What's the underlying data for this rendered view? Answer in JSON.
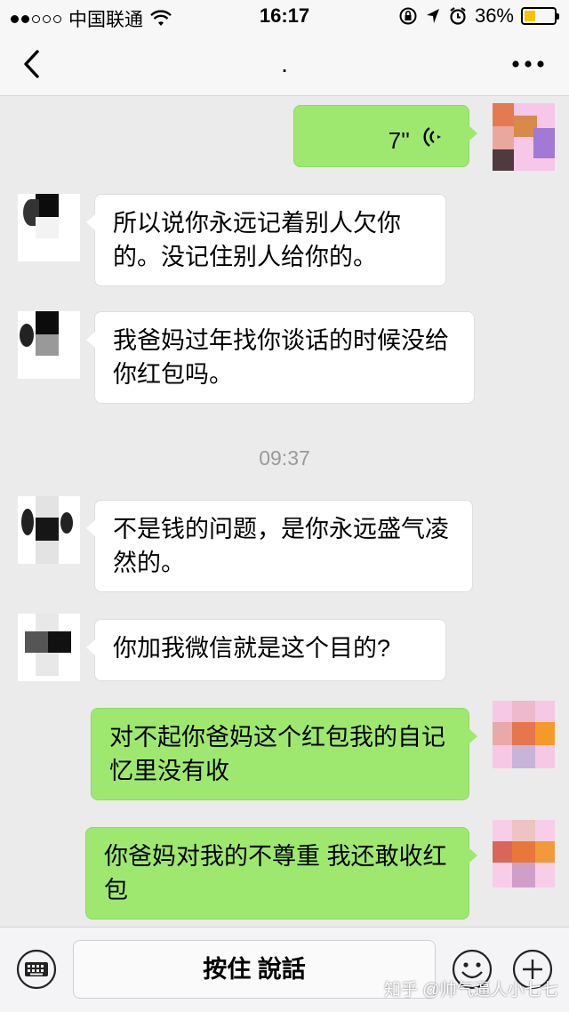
{
  "status_bar": {
    "carrier": "中国联通",
    "time": "16:17",
    "battery": "36%",
    "battery_level": 0.36,
    "signal_bars_filled": 2,
    "signal_bars_total": 5
  },
  "header": {
    "title": "."
  },
  "messages": [
    {
      "side": "out",
      "type": "voice",
      "duration": "7''"
    },
    {
      "side": "in",
      "text": "所以说你永远记着别人欠你的。没记住别人给你的。"
    },
    {
      "side": "in",
      "text": "我爸妈过年找你谈话的时候没给你红包吗。"
    },
    {
      "side": "in",
      "text": "不是钱的问题，是你永远盛气凌然的。"
    },
    {
      "side": "in",
      "text": "你加我微信就是这个目的?"
    },
    {
      "side": "out",
      "text": "对不起你爸妈这个红包我的自记忆里没有收"
    },
    {
      "side": "out",
      "text": "你爸妈对我的不尊重 我还敢收红包"
    }
  ],
  "timestamp": "09:37",
  "input_bar": {
    "hold_to_talk_label": "按住 說話"
  },
  "watermark": "知乎 @帅气逼人小七七",
  "colors": {
    "outgoing_bubble": "#9ee870",
    "incoming_bubble": "#ffffff",
    "background": "#ebebeb",
    "battery_fill": "#f5c500"
  }
}
